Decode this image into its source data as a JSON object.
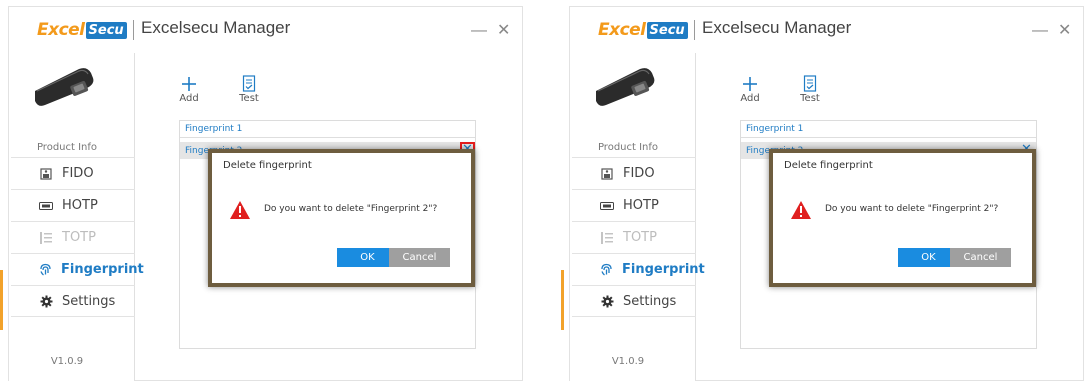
{
  "screens": [
    {
      "logo": {
        "excel": "Excel",
        "secu": "Secu"
      },
      "title": "Excelsecu Manager",
      "window_controls": {
        "minimize": "—",
        "close": "✕"
      },
      "sidebar": {
        "product_info": "Product Info",
        "items": [
          {
            "label": "FIDO",
            "icon": "fido-icon"
          },
          {
            "label": "HOTP",
            "icon": "hotp-icon"
          },
          {
            "label": "TOTP",
            "icon": "totp-icon",
            "disabled": true
          },
          {
            "label": "Fingerprint",
            "icon": "fingerprint-icon",
            "active": true
          },
          {
            "label": "Settings",
            "icon": "gear-icon"
          }
        ],
        "version": "V1.0.9"
      },
      "toolbar": {
        "add": "Add",
        "test": "Test"
      },
      "list": {
        "items": [
          "Fingerprint 1",
          "Fingerprint 2"
        ],
        "delete_glyph": "✕",
        "delete_highlighted": true
      },
      "dialog": {
        "title": "Delete fingerprint",
        "message": "Do you want to delete \"Fingerprint 2\"?",
        "ok": "OK",
        "cancel": "Cancel"
      }
    },
    {
      "logo": {
        "excel": "Excel",
        "secu": "Secu"
      },
      "title": "Excelsecu Manager",
      "window_controls": {
        "minimize": "—",
        "close": "✕"
      },
      "sidebar": {
        "product_info": "Product Info",
        "items": [
          {
            "label": "FIDO",
            "icon": "fido-icon"
          },
          {
            "label": "HOTP",
            "icon": "hotp-icon"
          },
          {
            "label": "TOTP",
            "icon": "totp-icon",
            "disabled": true
          },
          {
            "label": "Fingerprint",
            "icon": "fingerprint-icon",
            "active": true
          },
          {
            "label": "Settings",
            "icon": "gear-icon"
          }
        ],
        "version": "V1.0.9"
      },
      "toolbar": {
        "add": "Add",
        "test": "Test"
      },
      "list": {
        "items": [
          "Fingerprint 1",
          "Fingerprint 2"
        ],
        "delete_glyph": "✕",
        "delete_highlighted": false
      },
      "dialog": {
        "title": "Delete fingerprint",
        "message": "Do you want to delete \"Fingerprint 2\"?",
        "ok": "OK",
        "cancel": "Cancel"
      }
    }
  ],
  "colors": {
    "brand_orange": "#f39a1b",
    "brand_blue": "#1f7cc4",
    "ok_button": "#1a8ce0",
    "cancel_button": "#9f9f9f",
    "highlight_red": "#e51d1d"
  }
}
